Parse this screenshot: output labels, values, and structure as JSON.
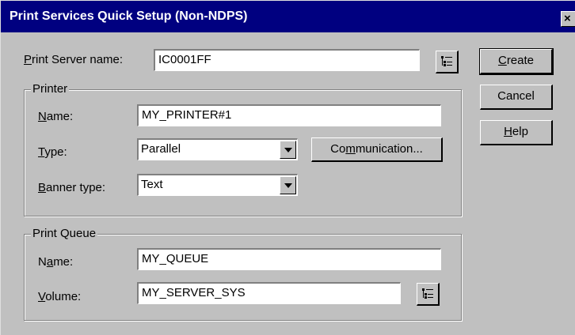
{
  "window": {
    "title": "Print Services Quick Setup (Non-NDPS)",
    "close_glyph": "×"
  },
  "server": {
    "label_hotkey": "P",
    "label_rest": "rint Server name:",
    "value": "IC0001FF"
  },
  "printer": {
    "group_title": "Printer",
    "name": {
      "label_hotkey": "N",
      "label_rest": "ame:",
      "value": "MY_PRINTER#1"
    },
    "type": {
      "label_hotkey": "T",
      "label_rest": "ype:",
      "value": "Parallel"
    },
    "banner": {
      "label_hotkey": "B",
      "label_rest": "anner type:",
      "value": "Text"
    },
    "communication": {
      "label_pre": "Co",
      "label_hotkey": "m",
      "label_rest": "munication..."
    }
  },
  "queue": {
    "group_title": "Print Queue",
    "name": {
      "label_pre": "N",
      "label_hotkey": "a",
      "label_rest": "me:",
      "value": "MY_QUEUE"
    },
    "volume": {
      "label_hotkey": "V",
      "label_rest": "olume:",
      "value": "MY_SERVER_SYS"
    }
  },
  "buttons": {
    "create": {
      "label_hotkey": "C",
      "label_rest": "reate"
    },
    "cancel": {
      "label": "Cancel"
    },
    "help": {
      "label_hotkey": "H",
      "label_rest": "elp"
    }
  },
  "icons": {
    "browse": "tree-browse-icon",
    "close": "close-icon",
    "dropdown": "chevron-down-icon"
  }
}
